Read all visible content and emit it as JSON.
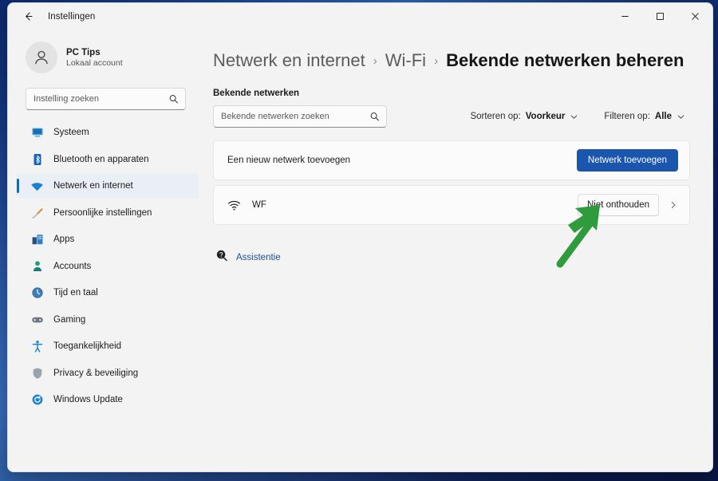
{
  "window": {
    "app_title": "Instellingen",
    "back_icon": "back-arrow-icon",
    "controls": {
      "minimize": "minimize-icon",
      "maximize": "maximize-icon",
      "close": "close-icon"
    }
  },
  "sidebar": {
    "profile": {
      "name": "PC Tips",
      "subtitle": "Lokaal account",
      "avatar_icon": "person-avatar-icon"
    },
    "search": {
      "placeholder": "Instelling zoeken",
      "value": "",
      "icon": "search-icon"
    },
    "items": [
      {
        "label": "Systeem",
        "icon": "system-icon",
        "active": false
      },
      {
        "label": "Bluetooth en apparaten",
        "icon": "bluetooth-icon",
        "active": false
      },
      {
        "label": "Netwerk en internet",
        "icon": "network-icon",
        "active": true
      },
      {
        "label": "Persoonlijke instellingen",
        "icon": "personalization-brush-icon",
        "active": false
      },
      {
        "label": "Apps",
        "icon": "apps-icon",
        "active": false
      },
      {
        "label": "Accounts",
        "icon": "accounts-icon",
        "active": false
      },
      {
        "label": "Tijd en taal",
        "icon": "time-language-icon",
        "active": false
      },
      {
        "label": "Gaming",
        "icon": "gaming-controller-icon",
        "active": false
      },
      {
        "label": "Toegankelijkheid",
        "icon": "accessibility-icon",
        "active": false
      },
      {
        "label": "Privacy & beveiliging",
        "icon": "shield-icon",
        "active": false
      },
      {
        "label": "Windows Update",
        "icon": "windows-update-icon",
        "active": false
      }
    ]
  },
  "main": {
    "breadcrumb": [
      {
        "label": "Netwerk en internet",
        "current": false
      },
      {
        "label": "Wi-Fi",
        "current": false
      },
      {
        "label": "Bekende netwerken beheren",
        "current": true
      }
    ],
    "breadcrumb_separator": "›",
    "section_title": "Bekende netwerken",
    "network_search": {
      "placeholder": "Bekende netwerken zoeken",
      "value": "",
      "icon": "search-icon"
    },
    "sort_dropdown": {
      "label": "Sorteren op:",
      "value": "Voorkeur",
      "icon": "chevron-down-icon"
    },
    "filter_dropdown": {
      "label": "Filteren op:",
      "value": "Alle",
      "icon": "chevron-down-icon"
    },
    "add_network_row": {
      "text": "Een nieuw netwerk toevoegen",
      "button_label": "Netwerk toevoegen"
    },
    "networks": [
      {
        "name": "WF",
        "icon": "wifi-icon",
        "button_label": "Niet onthouden",
        "chevron": "chevron-right-icon"
      }
    ],
    "help": {
      "label": "Assistentie",
      "icon": "help-assistance-icon"
    }
  },
  "annotation": {
    "arrow_color": "#2e9b3c",
    "name": "green-arrow-annotation"
  },
  "colors": {
    "accent_blue": "#1a56ad",
    "selection_indicator": "#0f6cbd",
    "link_blue": "#1d4f91",
    "window_bg": "#f3f3f3",
    "card_bg": "#fbfbfb",
    "desktop_blue": "#0f1f5c"
  }
}
